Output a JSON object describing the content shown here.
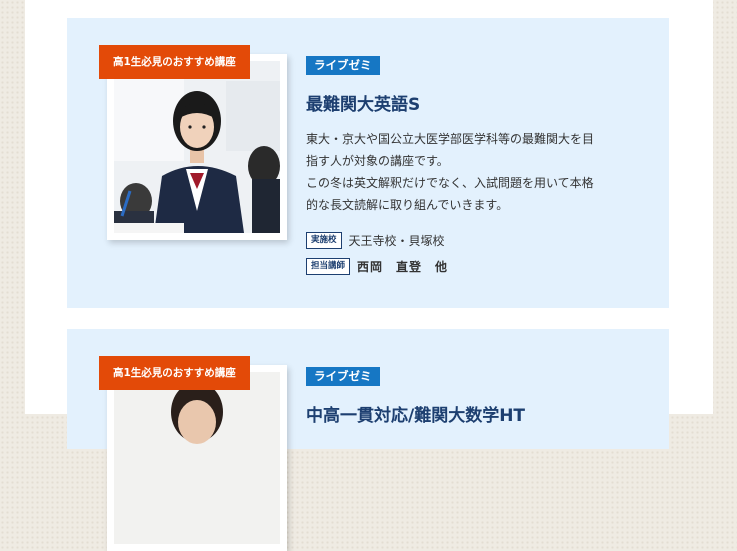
{
  "courses": [
    {
      "badge": "高1生必見のおすすめ講座",
      "tag": "ライブゼミ",
      "title": "最難関大英語S",
      "description": [
        "東大・京大や国公立大医学部医学科等の最難関大を目",
        "指す人が対象の講座です。",
        "この冬は英文解釈だけでなく、入試問題を用いて本格",
        "的な長文読解に取り組んでいきます。"
      ],
      "school_label": "実施校",
      "school_value": "天王寺校・貝塚校",
      "teacher_label": "担当講師",
      "teacher_value": "西岡　直登　他"
    },
    {
      "badge": "高1生必見のおすすめ講座",
      "tag": "ライブゼミ",
      "title": "中高一貫対応/難関大数学HT"
    }
  ]
}
